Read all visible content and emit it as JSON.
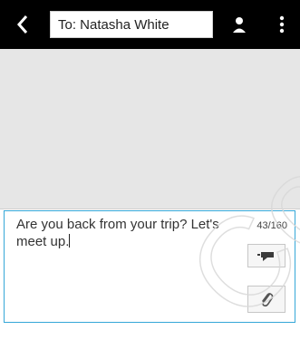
{
  "header": {
    "to_text": "To: Natasha White",
    "back_icon": "chevron-left-icon",
    "contact_icon": "person-icon",
    "menu_icon": "vertical-dots-icon"
  },
  "composer": {
    "message": "Are you back from your trip? Let's meet up.",
    "char_count": "43/160",
    "send_icon": "send-icon",
    "attach_icon": "paperclip-icon"
  },
  "watermark": {
    "text": "Con"
  },
  "colors": {
    "topbar": "#000000",
    "thread_bg": "#e6e6e6",
    "accent_border": "#35a7d8"
  }
}
